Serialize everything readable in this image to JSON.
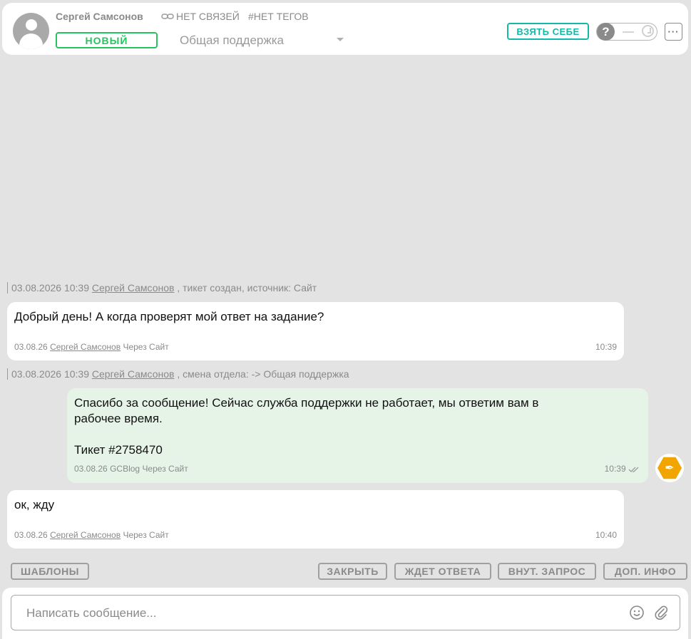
{
  "header": {
    "client_name": "Сергей Самсонов",
    "links_label": "НЕТ СВЯЗЕЙ",
    "tags_label": "#НЕТ ТЕГОВ",
    "status": "НОВЫЙ",
    "department": "Общая поддержка",
    "take_button": "ВЗЯТЬ СЕБЕ",
    "toggle_icon": "question-icon",
    "more_label": "···"
  },
  "events": [
    {
      "time": "03.08.2026 10:39",
      "author": "Сергей Самсонов",
      "text": ", тикет создан, источник: Сайт"
    },
    {
      "time": "03.08.2026 10:39",
      "author": "Сергей Самсонов",
      "text": ", смена отдела: -> Общая поддержка"
    }
  ],
  "messages": [
    {
      "text": "Добрый день! А когда проверят мой ответ на задание?",
      "date": "03.08.26",
      "author": "Сергей Самсонов",
      "via": "Через Сайт",
      "time": "10:39"
    },
    {
      "line1": "Спасибо за сообщение! Сейчас служба поддержки не работает, мы ответим вам в",
      "line2": "рабочее время.",
      "line3": "Тикет #2758470",
      "date": "03.08.26",
      "author": "GCBlog",
      "via": "Через Сайт",
      "time": "10:39"
    },
    {
      "text": "ок, жду",
      "date": "03.08.26",
      "author": "Сергей Самсонов",
      "via": "Через Сайт",
      "time": "10:40"
    }
  ],
  "actions": {
    "templates": "ШАБЛОНЫ",
    "close": "ЗАКРЫТЬ",
    "awaiting": "ЖДЕТ ОТВЕТА",
    "internal": "ВНУТ. ЗАПРОС",
    "info": "ДОП. ИНФО"
  },
  "compose": {
    "placeholder": "Написать сообщение..."
  },
  "colors": {
    "status_green": "#22c55e",
    "take_teal": "#14b8a6",
    "outgoing_bg": "#e6f4e8",
    "agent_avatar": "#f0a500"
  }
}
